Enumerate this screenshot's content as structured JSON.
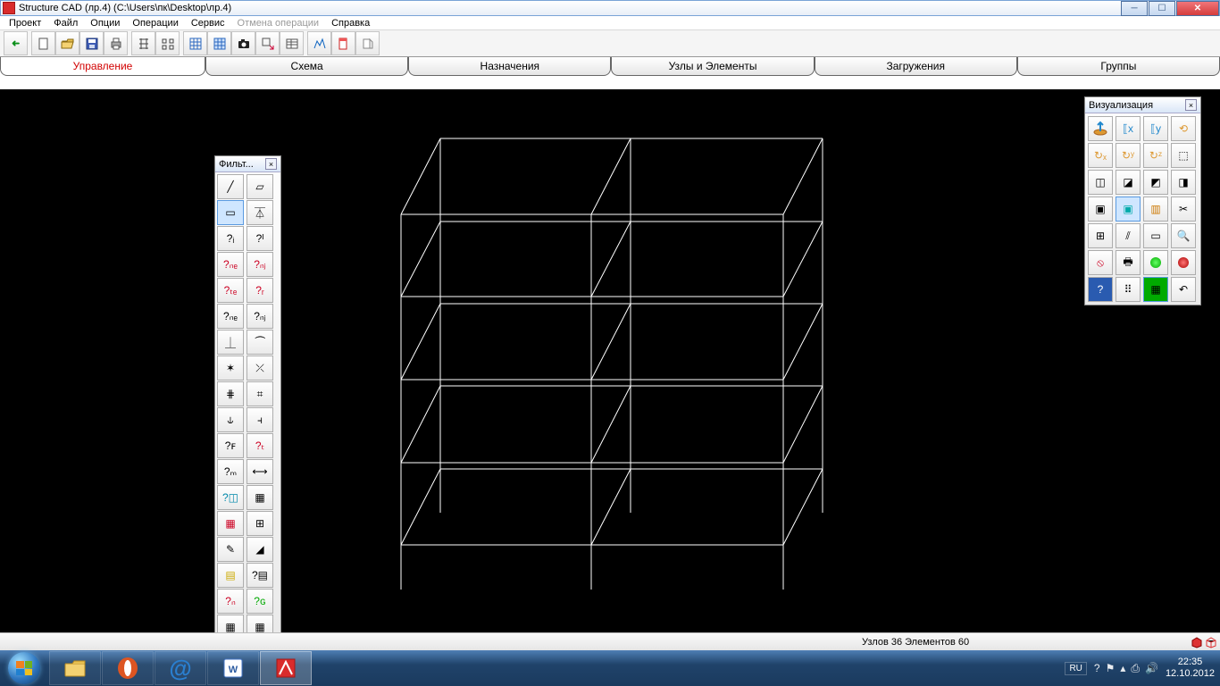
{
  "window": {
    "title": "Structure CAD (лр.4) (C:\\Users\\пк\\Desktop\\лр.4)"
  },
  "menu": {
    "project": "Проект",
    "file": "Файл",
    "options": "Опции",
    "operations": "Операции",
    "service": "Сервис",
    "undo": "Отмена операции",
    "help": "Справка"
  },
  "tabs": {
    "management": "Управление",
    "schema": "Схема",
    "assignments": "Назначения",
    "nodes_elements": "Узлы и Элементы",
    "loadings": "Загружения",
    "groups": "Группы"
  },
  "panels": {
    "filter": "Фильт...",
    "visualization": "Визуализация"
  },
  "status": {
    "info": "Узлов 36 Элементов 60"
  },
  "tray": {
    "lang": "RU",
    "time": "22:35",
    "date": "12.10.2012"
  }
}
